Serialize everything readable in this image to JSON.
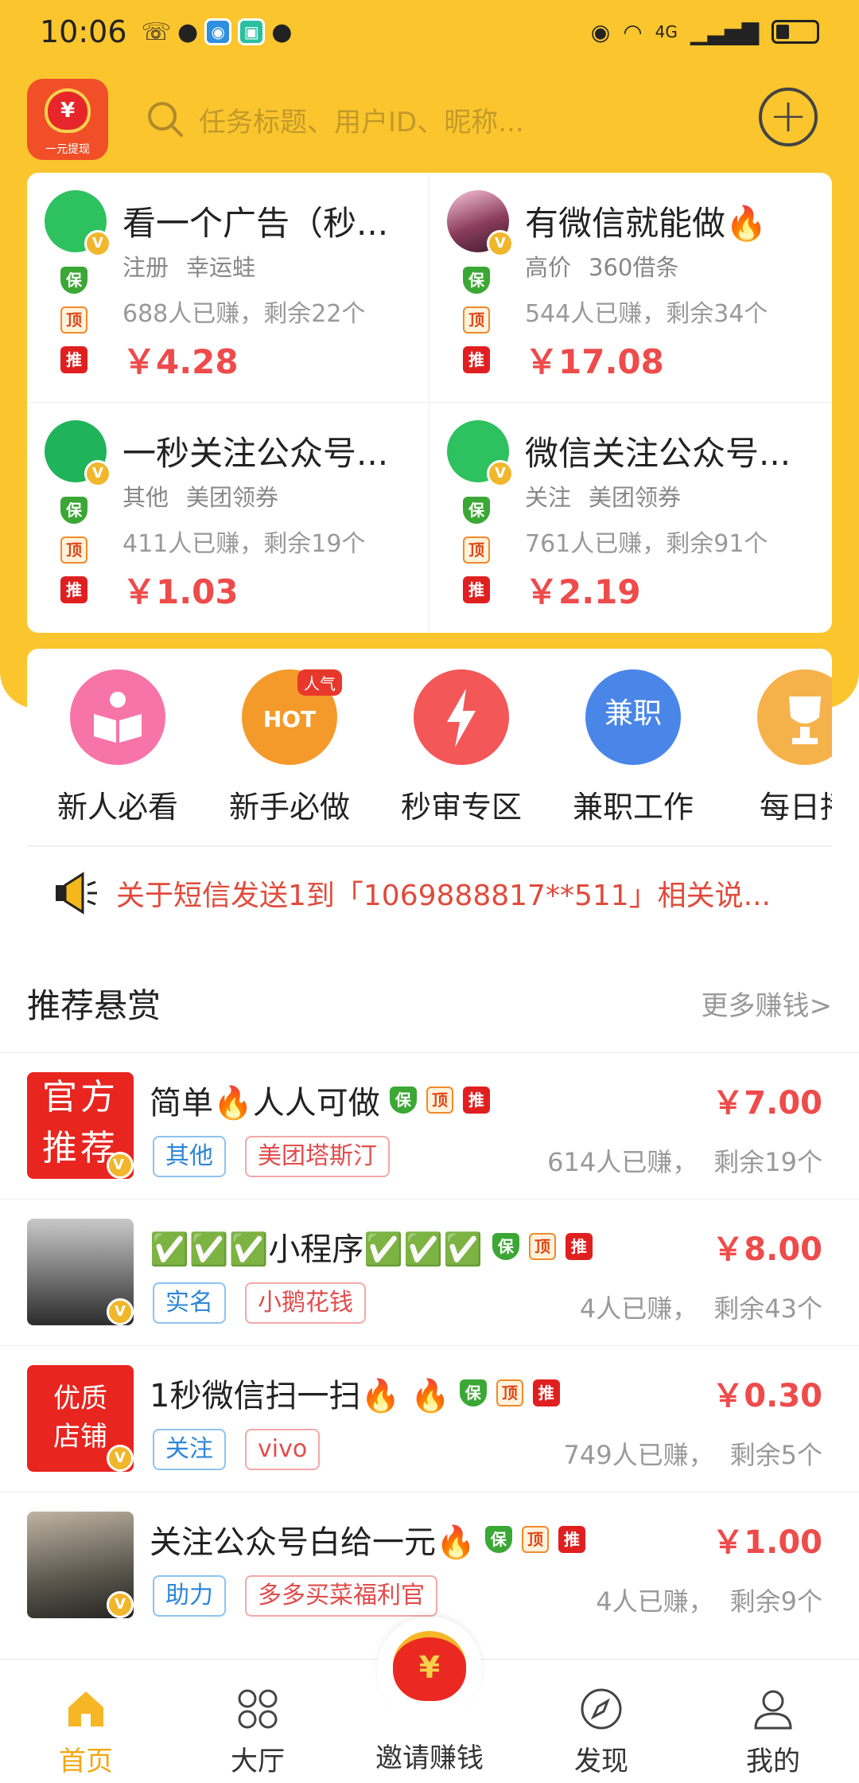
{
  "status_bar": {
    "time": "10:06",
    "net": "4G"
  },
  "header": {
    "search_placeholder": "任务标题、用户ID、昵称...",
    "logo_caption": "一元提现",
    "logo_symbol": "¥"
  },
  "featured": [
    {
      "title": "看一个广告（秒...",
      "tag1": "注册",
      "tag2": "幸运蛙",
      "stat": "688人已赚，剩余22个",
      "price": "￥4.28"
    },
    {
      "title": "有微信就能做🔥",
      "tag1": "高价",
      "tag2": "360借条",
      "stat": "544人已赚，剩余34个",
      "price": "￥17.08"
    },
    {
      "title": "一秒关注公众号...",
      "tag1": "其他",
      "tag2": "美团领券",
      "stat": "411人已赚，剩余19个",
      "price": "￥1.03"
    },
    {
      "title": "微信关注公众号...",
      "tag1": "关注",
      "tag2": "美团领券",
      "stat": "761人已赚，剩余91个",
      "price": "￥2.19"
    }
  ],
  "badges": {
    "bao": "保",
    "ding": "顶",
    "tui": "推",
    "v": "V"
  },
  "quick_entries": [
    {
      "label": "新人必看",
      "color": "#f774a8"
    },
    {
      "label": "新手必做",
      "color": "#f49a2b",
      "hot": "HOT",
      "ribbon": "人气"
    },
    {
      "label": "秒审专区",
      "color": "#f45757"
    },
    {
      "label": "兼职工作",
      "color": "#4a86e8",
      "icon_text": "兼职"
    },
    {
      "label": "每日播",
      "color": "#f6b24a"
    }
  ],
  "notice": "关于短信发送1到「1069888817**511」相关说...",
  "section": {
    "title": "推荐悬赏",
    "more": "更多赚钱>"
  },
  "tasks": [
    {
      "title": "简单🔥人人可做",
      "price": "￥7.00",
      "tag1": "其他",
      "tag2": "美团塔斯汀",
      "earned": "614人已赚，",
      "remain": "剩余19个",
      "thumb_text": "官方推荐"
    },
    {
      "title": "✅✅✅小程序✅✅✅",
      "price": "￥8.00",
      "tag1": "实名",
      "tag2": "小鹅花钱",
      "earned": "4人已赚，",
      "remain": "剩余43个"
    },
    {
      "title": "1秒微信扫一扫🔥 🔥",
      "price": "￥0.30",
      "tag1": "关注",
      "tag2": "vivo",
      "earned": "749人已赚，",
      "remain": "剩余5个",
      "thumb_text": "优质店铺"
    },
    {
      "title": "关注公众号白给一元🔥",
      "price": "￥1.00",
      "tag1": "助力",
      "tag2": "多多买菜福利官",
      "earned": "4人已赚，",
      "remain": "剩余9个"
    }
  ],
  "tabbar": {
    "home": "首页",
    "hall": "大厅",
    "invite": "邀请赚钱",
    "discover": "发现",
    "mine": "我的",
    "active": "home",
    "accent": "#f2a712"
  }
}
